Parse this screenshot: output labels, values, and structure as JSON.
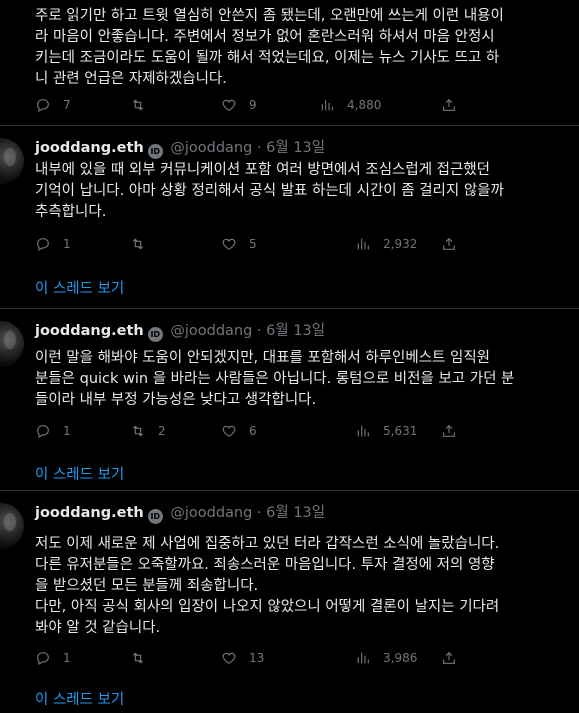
{
  "tweets": [
    {
      "author": null,
      "lines": [
        "주로 읽기만 하고 트윗 열심히 안쓴지 좀 됐는데, 오랜만에 쓰는게 이런 내용이",
        "라 마음이 안좋습니다. 주변에서 정보가 없어 혼란스러워 하셔서 마음 안정시",
        "키는데 조금이라도 도움이 될까 해서 적었는데요, 이제는 뉴스 기사도 뜨고 하",
        "니 관련 언급은 자제하겠습니다."
      ],
      "replies": "7",
      "reposts": "",
      "likes": "9",
      "views": "4,880",
      "thread_link": ""
    },
    {
      "author": {
        "name": "jooddang.eth",
        "badge": "ID",
        "handle": "@jooddang",
        "dot": "·",
        "date": "6월 13일"
      },
      "lines": [
        "내부에 있을 때 외부 커뮤니케이션 포함 여러 방면에서 조심스럽게 접근했던",
        "기억이 납니다. 아마 상황 정리해서 공식 발표 하는데 시간이 좀 걸리지 않을까",
        "추측합니다."
      ],
      "replies": "1",
      "reposts": "",
      "likes": "5",
      "views": "2,932",
      "thread_link": "이 스레드 보기"
    },
    {
      "author": {
        "name": "jooddang.eth",
        "badge": "ID",
        "handle": "@jooddang",
        "dot": "·",
        "date": "6월 13일"
      },
      "lines": [
        "이런 말을 해봐야 도움이 안되겠지만, 대표를 포함해서 하루인베스트 임직원",
        "분들은 quick win 을 바라는 사람들은 아닙니다. 롱텀으로 비전을 보고 가던 분",
        "들이라 내부 부정 가능성은 낮다고 생각합니다."
      ],
      "replies": "1",
      "reposts": "2",
      "likes": "6",
      "views": "5,631",
      "thread_link": "이 스레드 보기"
    },
    {
      "author": {
        "name": "jooddang.eth",
        "badge": "ID",
        "handle": "@jooddang",
        "dot": "·",
        "date": "6월 13일"
      },
      "lines": [
        "저도 이제 새로운 제 사업에 집중하고 있던 터라 갑작스런 소식에 놀랐습니다.",
        "다른 유저분들은 오죽할까요. 죄송스러운 마음입니다. 투자 결정에 저의 영향",
        "을 받으셨던 모든 분들께 죄송합니다.",
        "다만, 아직 공식 회사의 입장이 나오지 않았으니 어떻게 결론이 날지는 기다려",
        "봐야 알 것 같습니다."
      ],
      "replies": "1",
      "reposts": "",
      "likes": "13",
      "views": "3,986",
      "thread_link": "이 스레드 보기"
    }
  ],
  "icons": {
    "reply": "reply-icon",
    "repost": "repost-icon",
    "like": "heart-icon",
    "views": "views-icon",
    "share": "share-icon"
  },
  "colors": {
    "background": "#000000",
    "text": "#e7e9ea",
    "muted": "#71767b",
    "link": "#1d9bf0",
    "divider": "#2f3336"
  }
}
